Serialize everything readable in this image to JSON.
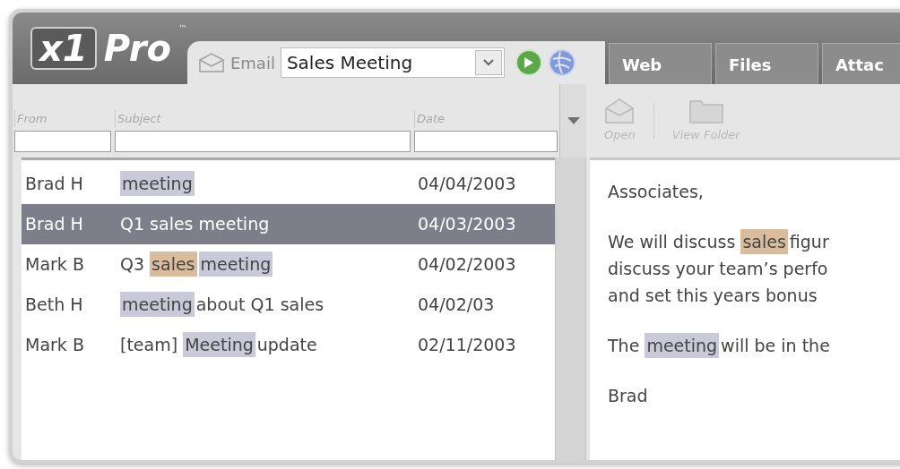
{
  "logo": {
    "mark": "x1",
    "name": "Pro",
    "trademark": "™"
  },
  "tabs": [
    {
      "label": "Email",
      "selected": true
    },
    {
      "label": "Web",
      "selected": false
    },
    {
      "label": "Files",
      "selected": false
    },
    {
      "label": "Attac",
      "selected": false
    }
  ],
  "search": {
    "value": "Sales Meeting"
  },
  "filter_columns": [
    {
      "label": "From"
    },
    {
      "label": "Subject"
    },
    {
      "label": "Date"
    }
  ],
  "toolbar": [
    {
      "label": "Open",
      "kind": "envelope",
      "disabled": true
    },
    {
      "label": "View Folder",
      "kind": "folder",
      "disabled": true
    }
  ],
  "messages": [
    {
      "from": "Brad H",
      "subject": [
        {
          "text": "meeting",
          "color": "#c9c9d9"
        }
      ],
      "date": "04/04/2003",
      "selected": false
    },
    {
      "from": "Brad H",
      "subject": [
        {
          "text": "Q1 sales meeting"
        }
      ],
      "date": "04/03/2003",
      "selected": true
    },
    {
      "from": "Mark B",
      "subject": [
        {
          "text": "Q3 "
        },
        {
          "text": "sales",
          "color": "#d9bc9c"
        },
        {
          "text": "meeting",
          "color": "#c9c9d9"
        }
      ],
      "date": "04/02/2003",
      "selected": false
    },
    {
      "from": "Beth H",
      "subject": [
        {
          "text": "meeting",
          "color": "#c9c9d9"
        },
        {
          "text": "about Q1 sales"
        }
      ],
      "date": "04/02/03",
      "selected": false
    },
    {
      "from": "Mark B",
      "subject": [
        {
          "text": "[team] "
        },
        {
          "text": "Meeting",
          "color": "#c9c9d9"
        },
        {
          "text": "update"
        }
      ],
      "date": "02/11/2003",
      "selected": false
    }
  ],
  "preview": {
    "paragraphs": [
      [
        [
          {
            "text": "Associates,"
          }
        ]
      ],
      [
        [
          {
            "text": "We will discuss "
          },
          {
            "text": "sales",
            "color": "#d9bc9c"
          },
          {
            "text": "figur"
          }
        ],
        [
          {
            "text": "discuss your team’s perfo"
          }
        ],
        [
          {
            "text": "and set this years bonus"
          }
        ]
      ],
      [
        [
          {
            "text": "The "
          },
          {
            "text": "meeting",
            "color": "#c9c9d9"
          },
          {
            "text": "will be in the"
          }
        ]
      ],
      [
        [
          {
            "text": "Brad"
          }
        ]
      ]
    ]
  }
}
